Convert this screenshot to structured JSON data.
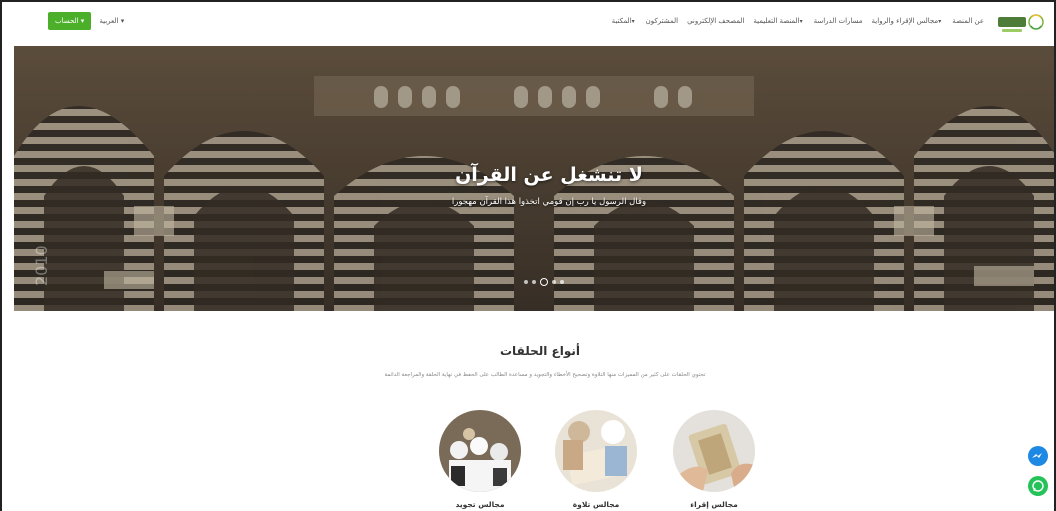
{
  "nav": {
    "items": [
      {
        "label": "عن المنصة",
        "caret": false
      },
      {
        "label": "مجالس الإقراء والرواية",
        "caret": true
      },
      {
        "label": "مسارات الدراسة",
        "caret": false
      },
      {
        "label": "المنصة التعليمية",
        "caret": true
      },
      {
        "label": "المصحف الإلكتروني",
        "caret": false
      },
      {
        "label": "المشتركون",
        "caret": false
      },
      {
        "label": "المكتبة",
        "caret": true
      }
    ],
    "account_label": "الحساب ▾",
    "language_label": "العربية ▾"
  },
  "hero": {
    "title": "لا تنشغل عن القرآن",
    "subtitle": "وقال الرسول يا رب إن قومي اتخذوا هذا القرآن مهجورا",
    "slide_count": 5,
    "active_slide": 3,
    "watermark": "2010"
  },
  "section": {
    "title": "أنواع الحلقات",
    "description": "تحتوي الحلقات على كثير من المميزات منها التلاوة وتصحيح الأخطاء والتجويد و مساعدة الطالب على الحفظ في نهاية الحلقة والمراجعة الدائمة"
  },
  "cards": [
    {
      "label": "مجالس تجويد"
    },
    {
      "label": "مجالس تلاوة"
    },
    {
      "label": "مجالس إقراء"
    }
  ],
  "colors": {
    "accent": "#4caf2a",
    "messenger": "#1e88e5",
    "whatsapp": "#25c25a"
  },
  "icons": [
    "messenger-icon",
    "whatsapp-icon",
    "platform-logo"
  ]
}
